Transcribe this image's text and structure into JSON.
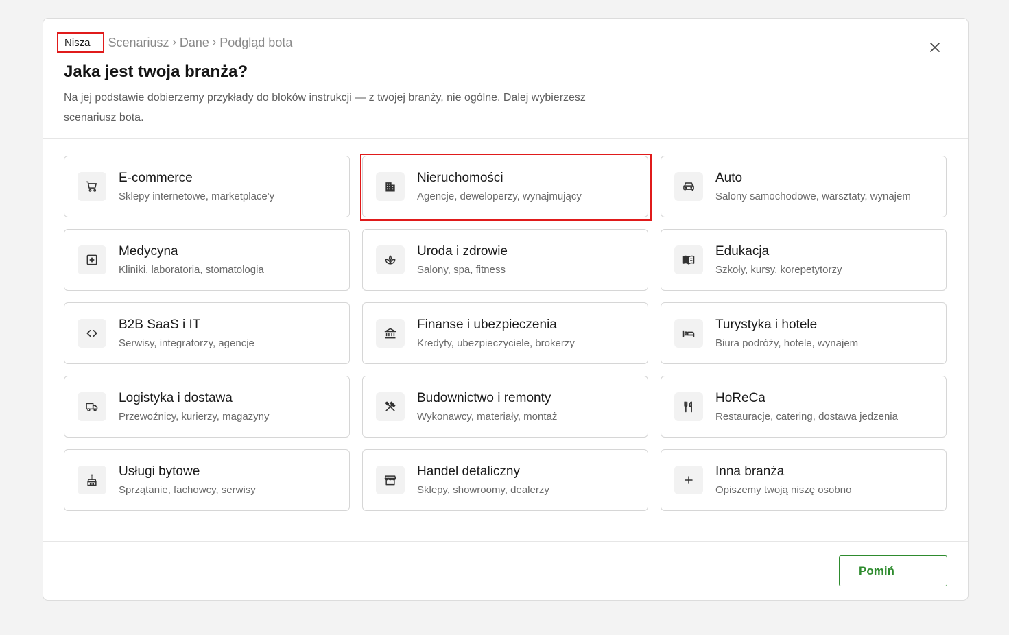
{
  "breadcrumb": {
    "current": "Nisza",
    "steps": [
      "Scenariusz",
      "Dane",
      "Podgląd bota"
    ],
    "separator": "›"
  },
  "header": {
    "title": "Jaka jest twoja branża?",
    "subtitle": "Na jej podstawie dobierzemy przykłady do bloków instrukcji — z twojej branży, nie ogólne. Dalej wybierzesz scenariusz bota."
  },
  "industries": [
    {
      "title": "E-commerce",
      "desc": "Sklepy internetowe, marketplace'y",
      "icon": "cart-icon"
    },
    {
      "title": "Nieruchomości",
      "desc": "Agencje, deweloperzy, wynajmujący",
      "icon": "building-icon",
      "highlighted": true
    },
    {
      "title": "Auto",
      "desc": "Salony samochodowe, warsztaty, wynajem",
      "icon": "car-icon"
    },
    {
      "title": "Medycyna",
      "desc": "Kliniki, laboratoria, stomatologia",
      "icon": "medical-cross-icon"
    },
    {
      "title": "Uroda i zdrowie",
      "desc": "Salony, spa, fitness",
      "icon": "spa-icon"
    },
    {
      "title": "Edukacja",
      "desc": "Szkoły, kursy, korepetytorzy",
      "icon": "book-icon"
    },
    {
      "title": "B2B SaaS i IT",
      "desc": "Serwisy, integratorzy, agencje",
      "icon": "code-icon"
    },
    {
      "title": "Finanse i ubezpieczenia",
      "desc": "Kredyty, ubezpieczyciele, brokerzy",
      "icon": "bank-icon"
    },
    {
      "title": "Turystyka i hotele",
      "desc": "Biura podróży, hotele, wynajem",
      "icon": "bed-icon"
    },
    {
      "title": "Logistyka i dostawa",
      "desc": "Przewoźnicy, kurierzy, magazyny",
      "icon": "truck-icon"
    },
    {
      "title": "Budownictwo i remonty",
      "desc": "Wykonawcy, materiały, montaż",
      "icon": "tools-icon"
    },
    {
      "title": "HoReCa",
      "desc": "Restauracje, catering, dostawa jedzenia",
      "icon": "utensils-icon"
    },
    {
      "title": "Usługi bytowe",
      "desc": "Sprzątanie, fachowcy, serwisy",
      "icon": "broom-icon"
    },
    {
      "title": "Handel detaliczny",
      "desc": "Sklepy, showroomy, dealerzy",
      "icon": "store-icon"
    },
    {
      "title": "Inna branża",
      "desc": "Opiszemy twoją niszę osobno",
      "icon": "plus-icon"
    }
  ],
  "footer": {
    "skip_label": "Pomiń"
  },
  "colors": {
    "accent": "#2e8b2e",
    "highlight_border": "#e01b1b"
  }
}
